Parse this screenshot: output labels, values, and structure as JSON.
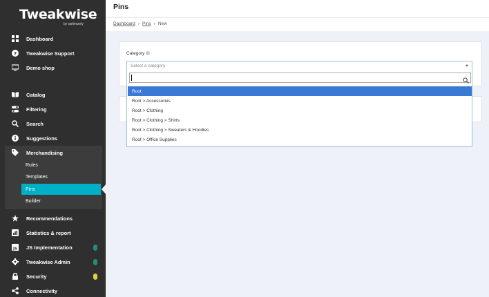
{
  "app": {
    "logo": "Tweakwise",
    "logo_sub": "by optimizely"
  },
  "sidebar": {
    "items": [
      {
        "label": "Dashboard",
        "icon": "grid-icon"
      },
      {
        "label": "Tweakwise Support",
        "icon": "question-icon"
      },
      {
        "label": "Demo shop",
        "icon": "monitor-icon"
      },
      {
        "label": "Catalog",
        "icon": "book-icon"
      },
      {
        "label": "Filtering",
        "icon": "toggle-icon"
      },
      {
        "label": "Search",
        "icon": "search-icon"
      },
      {
        "label": "Suggestions",
        "icon": "info-icon"
      },
      {
        "label": "Merchandising",
        "icon": "tag-icon"
      },
      {
        "label": "Recommendations",
        "icon": "star-icon"
      },
      {
        "label": "Statistics & report",
        "icon": "chart-icon"
      },
      {
        "label": "JS Implementation",
        "icon": "js-icon"
      },
      {
        "label": "Tweakwise Admin",
        "icon": "gear-icon"
      },
      {
        "label": "Security",
        "icon": "lock-icon"
      },
      {
        "label": "Connectivity",
        "icon": "share-icon"
      }
    ],
    "merch_sub": [
      {
        "label": "Rules"
      },
      {
        "label": "Templates"
      },
      {
        "label": "Pins"
      },
      {
        "label": "Builder"
      }
    ],
    "active_sub": "Pins",
    "colors": {
      "bg": "#2f2f2f",
      "active": "#00b0c7"
    }
  },
  "header": {
    "title": "Pins"
  },
  "breadcrumb": {
    "items": [
      "Dashboard",
      "Pins",
      "New"
    ]
  },
  "form": {
    "category_label": "Category",
    "select_placeholder": "Select a category",
    "search_value": "",
    "options": [
      "Root",
      "Root > Accessories",
      "Root > Clothing",
      "Root > Clothing > Shirts",
      "Root > Clothing > Sweaters & Hoodies",
      "Root > Office Supplies"
    ],
    "highlighted_option": "Root",
    "accent": "#3a79d4"
  }
}
